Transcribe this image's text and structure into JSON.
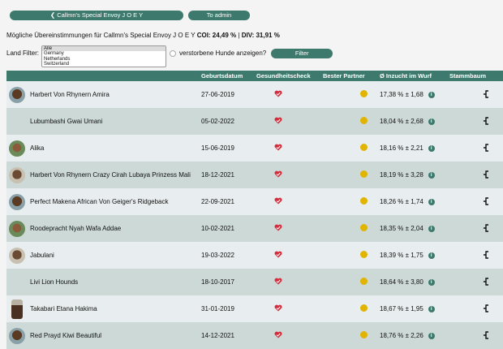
{
  "nav": {
    "back_label": "Callmn's Special Envoy J O E Y",
    "admin_label": "To admin"
  },
  "summary": {
    "prefix": "Mögliche Übereinstimmungen für Callmn's Special Envoy J O E Y",
    "coi": "COI: 24,49 %",
    "sep": " | ",
    "div": "DIV: 31,91 %"
  },
  "filter": {
    "label": "Land Filter:",
    "options": [
      "Alle",
      "Germany",
      "Netherlands",
      "Switzerland"
    ],
    "deceased_label": "verstorbene Hunde anzeigen?",
    "button_label": "Filter"
  },
  "table": {
    "headers": {
      "name": "",
      "date": "Geburtsdatum",
      "health": "Gesundheitscheck",
      "best": "Bester Partner",
      "inz": "Ø Inzucht im Wurf",
      "tree": "Stammbaum"
    },
    "rows": [
      {
        "name": "Harbert Von Rhynern Amira",
        "date": "27-06-2019",
        "inz": "17,38 % ± 1,68",
        "avatar": "dark"
      },
      {
        "name": "Lubumbashi Gwai Umani",
        "date": "05-02-2022",
        "inz": "18,04 % ± 2,68",
        "avatar": "none"
      },
      {
        "name": "Alika",
        "date": "15-06-2019",
        "inz": "18,16 % ± 2,21",
        "avatar": "normal"
      },
      {
        "name": "Harbert Von Rhynern Crazy Cirah Lubaya Prinzess Mali",
        "date": "18-12-2021",
        "inz": "18,19 % ± 3,28",
        "avatar": "gray"
      },
      {
        "name": "Perfect Makena African Von Geiger's Ridgeback",
        "date": "22-09-2021",
        "inz": "18,26 % ± 1,74",
        "avatar": "dark"
      },
      {
        "name": "Roodepracht Nyah Wafa Addae",
        "date": "10-02-2021",
        "inz": "18,35 % ± 2,04",
        "avatar": "normal"
      },
      {
        "name": "Jabulani",
        "date": "19-03-2022",
        "inz": "18,39 % ± 1,75",
        "avatar": "gray"
      },
      {
        "name": "Livi Lion Hounds",
        "date": "18-10-2017",
        "inz": "18,64 % ± 3,80",
        "avatar": "none"
      },
      {
        "name": "Takabari Etana Hakima",
        "date": "31-01-2019",
        "inz": "18,67 % ± 1,95",
        "avatar": "square"
      },
      {
        "name": "Red Prayd Kiwi Beautiful",
        "date": "14-12-2021",
        "inz": "18,76 % ± 2,26",
        "avatar": "dark"
      }
    ]
  },
  "icons": {
    "health": "heart-check-icon",
    "best": "yellow-dot-icon",
    "info": "info-icon",
    "tree": "pedigree-icon"
  },
  "colors": {
    "accent": "#3d7a6d",
    "partner_dot": "#e0b400",
    "heart": "#d62a3a"
  }
}
